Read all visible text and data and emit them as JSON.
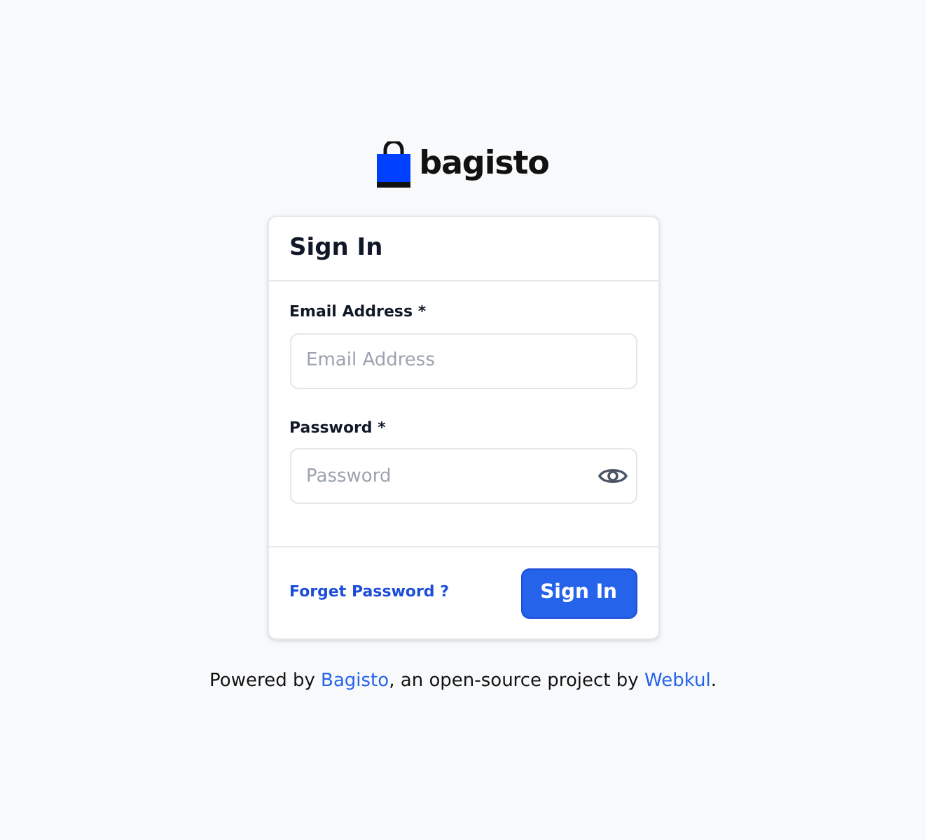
{
  "logo": {
    "text": "bagisto"
  },
  "card": {
    "title": "Sign In",
    "fields": [
      {
        "label": "Email Address *",
        "placeholder": "Email Address",
        "kind": "email"
      },
      {
        "label": "Password *",
        "placeholder": "Password",
        "kind": "password"
      }
    ],
    "forgot_link": "Forget Password ?",
    "submit_button": "Sign In"
  },
  "footer": {
    "parts": [
      {
        "kind": "text",
        "text": "Powered by "
      },
      {
        "kind": "link",
        "text": "Bagisto"
      },
      {
        "kind": "text",
        "text": ", an open-source project by "
      },
      {
        "kind": "link",
        "text": "Webkul"
      },
      {
        "kind": "text",
        "text": "."
      }
    ]
  }
}
